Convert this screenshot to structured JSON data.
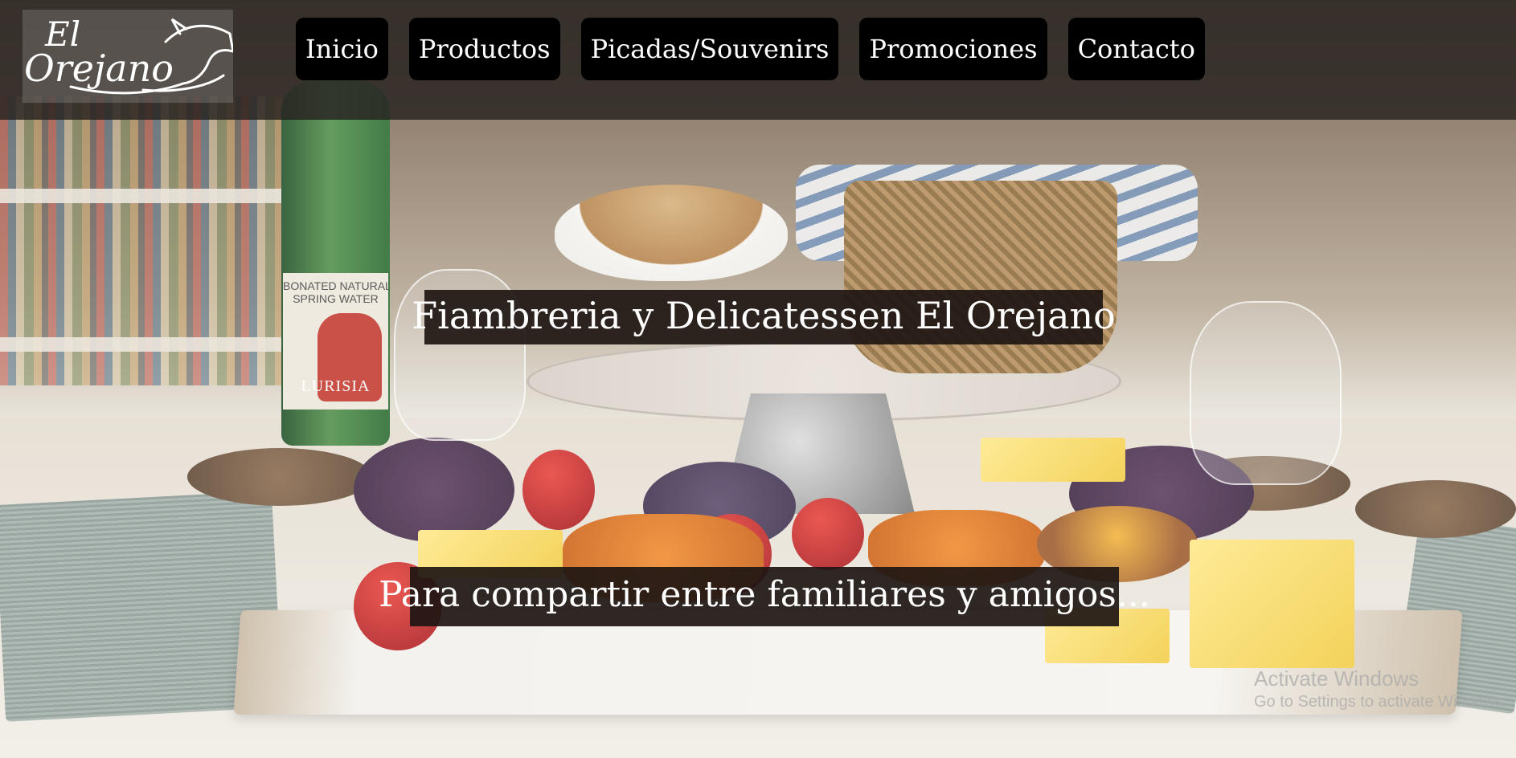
{
  "logo": {
    "line1": "El",
    "line2": "Orejano"
  },
  "nav": {
    "items": [
      {
        "label": "Inicio"
      },
      {
        "label": "Productos"
      },
      {
        "label": "Picadas/Souvenirs"
      },
      {
        "label": "Promociones"
      },
      {
        "label": "Contacto"
      }
    ]
  },
  "hero": {
    "title": "Fiambreria y Delicatessen El Orejano",
    "subtitle": "Para compartir entre familiares y amigos..."
  },
  "bottle_label": {
    "line1": "BONATED NATURAL",
    "line2": "SPRING WATER",
    "brand": "LURISIA"
  },
  "watermark": {
    "title": "Activate Windows",
    "subtitle": "Go to Settings to activate Windows."
  },
  "colors": {
    "header_bg": "#282421",
    "nav_button_bg": "#000000",
    "nav_text": "#ffffff",
    "caption_bg": "#1e1612"
  }
}
